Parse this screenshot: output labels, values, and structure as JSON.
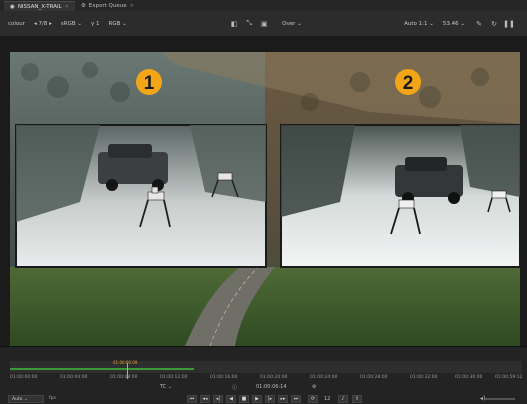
{
  "tabs": [
    {
      "label": "NISSAN_X-TRAIL",
      "active": true
    },
    {
      "label": "Export Queue",
      "active": false
    }
  ],
  "toolbar": {
    "colour_label": "colour",
    "frame": "7/8",
    "colorspace": "sRGB",
    "gamma": "1",
    "channels": "RGB",
    "overlay": "Over",
    "zoom": "Auto 1:1",
    "fps_display": "53.46"
  },
  "viewer": {
    "badge_1": "1",
    "badge_2": "2",
    "accent": "#f2a516"
  },
  "timeline": {
    "playhead_timecode": "01:00:06:09",
    "ticks": [
      "01:00:00:00",
      "01:00:04:00",
      "01:00:08:00",
      "01:00:12:00",
      "01:00:16:00",
      "01:00:20:00",
      "01:00:24:00",
      "01:00:28:00",
      "01:00:32:00",
      "01:00:36:00",
      "01:00:59:12"
    ]
  },
  "transport": {
    "tc_label": "TC",
    "current_timecode": "01:00:06:14",
    "fps_mode": "Auto",
    "fps_unit": "fps",
    "loop_count": "12"
  }
}
